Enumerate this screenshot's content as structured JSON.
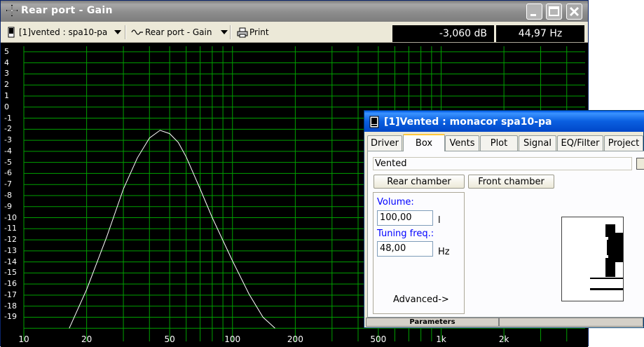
{
  "main_window": {
    "title": "Rear port - Gain",
    "toolbar": {
      "project_select": "[1]vented : spa10-pa",
      "graph_select": "Rear port - Gain",
      "print_label": "Print"
    },
    "readout_gain": "-3,060 dB",
    "readout_freq": "44,97 Hz"
  },
  "plot": {
    "y_ticks": [
      "5",
      "4",
      "3",
      "2",
      "1",
      "0",
      "-1",
      "-2",
      "-3",
      "-4",
      "-5",
      "-6",
      "-7",
      "-8",
      "-9",
      "-10",
      "-11",
      "-12",
      "-13",
      "-14",
      "-15",
      "-16",
      "-17",
      "-18",
      "-19"
    ],
    "x_ticks": [
      "10",
      "20",
      "50",
      "100",
      "200",
      "500",
      "1k",
      "2k"
    ],
    "grid_color": "#00a000",
    "curve_color": "#ffffff"
  },
  "chart_data": {
    "type": "line",
    "title": "",
    "xlabel": "",
    "ylabel": "",
    "xscale": "log",
    "xlim": [
      10,
      5000
    ],
    "ylim": [
      -20,
      6
    ],
    "grid": true,
    "series": [
      {
        "x": [
          16.5,
          20,
          25,
          30,
          35,
          40,
          44.97,
          50,
          55,
          60,
          70,
          80,
          100,
          120,
          140,
          160
        ],
        "y": [
          -20,
          -16.5,
          -11.7,
          -7.4,
          -4.6,
          -2.8,
          -2.1,
          -2.4,
          -3.2,
          -4.5,
          -7.4,
          -10,
          -13.9,
          -16.9,
          -19,
          -20
        ]
      }
    ]
  },
  "dialog": {
    "title": "[1]Vented : monacor spa10-pa",
    "tabs": [
      "Driver",
      "Box",
      "Vents",
      "Plot",
      "Signal",
      "EQ/Filter",
      "Project"
    ],
    "active_tab": "Box",
    "box_type": "Vented",
    "rear_chamber_label": "Rear chamber",
    "front_chamber_label": "Front chamber",
    "volume_label": "Volume:",
    "volume_value": "100,00",
    "volume_unit": "l",
    "tuning_label": "Tuning freq.:",
    "tuning_value": "48,00",
    "tuning_unit": "Hz",
    "advanced_label": "Advanced->",
    "status_panel": "Parameters"
  }
}
